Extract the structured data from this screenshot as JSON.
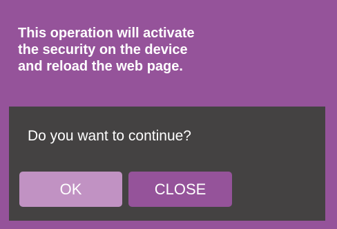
{
  "dialog": {
    "message_lines": [
      "This operation will activate",
      "the security on the device",
      "and reload the web page."
    ],
    "prompt": "Do you want to continue?",
    "ok_label": "OK",
    "close_label": "CLOSE"
  },
  "colors": {
    "dialog_background": "#95539a",
    "panel_background": "#444242",
    "ok_button": "#c192c3",
    "close_button": "#95539a",
    "text": "#ffffff"
  }
}
